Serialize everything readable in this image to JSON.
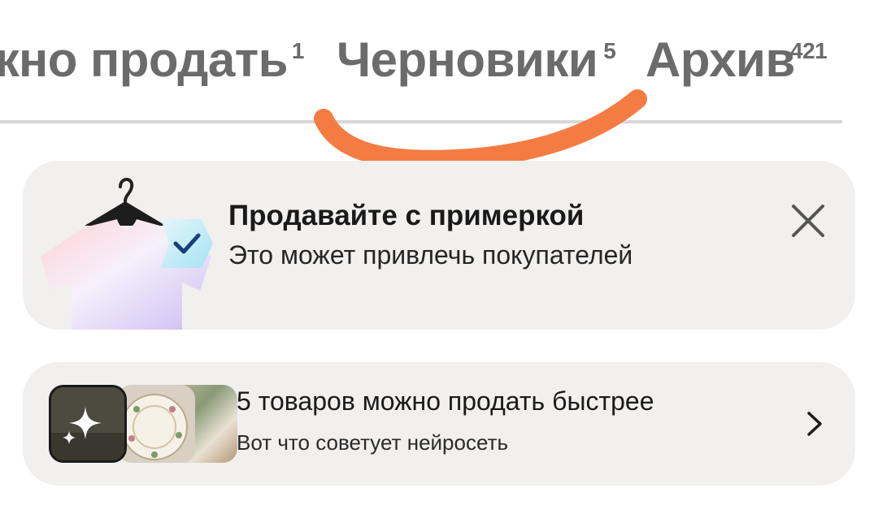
{
  "tabs": [
    {
      "label": "жно продать",
      "count": "1"
    },
    {
      "label": "Черновики",
      "count": "5"
    },
    {
      "label": "Архив",
      "count": "421"
    }
  ],
  "promo": {
    "title": "Продавайте с примеркой",
    "subtitle": "Это может привлечь покупателей",
    "image_icon": "tshirt-on-hanger-icon",
    "close_icon": "close-icon"
  },
  "ai_suggestions": {
    "title": "5 товаров можно продать быстрее",
    "subtitle": "Вот что советует нейросеть",
    "badge_icon": "sparkle-icon",
    "chevron_icon": "chevron-right-icon"
  },
  "colors": {
    "annotation_stroke": "#f47c43",
    "card_background": "#f1f0ef",
    "tab_text": "#6b6b6b"
  }
}
